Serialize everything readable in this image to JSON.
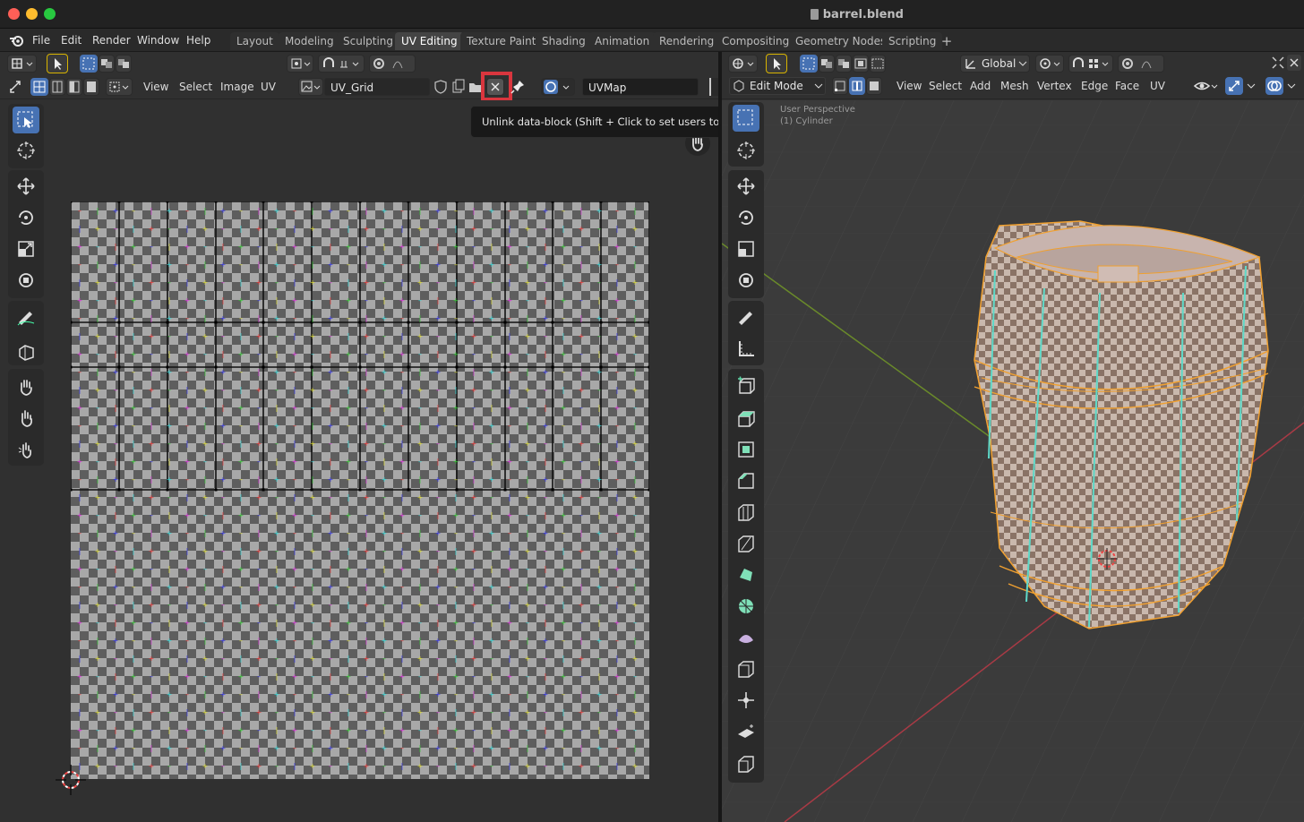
{
  "window": {
    "title": "barrel.blend"
  },
  "menubar": {
    "items": [
      "File",
      "Edit",
      "Render",
      "Window",
      "Help"
    ],
    "workspace_tabs": [
      "Layout",
      "Modeling",
      "Sculpting",
      "UV Editing",
      "Texture Paint",
      "Shading",
      "Animation",
      "Rendering",
      "Compositing",
      "Geometry Nodes",
      "Scripting"
    ],
    "active_tab": "UV Editing",
    "add_workspace": "+"
  },
  "uv_editor": {
    "menus": [
      "View",
      "Select",
      "Image",
      "UV"
    ],
    "image_name": "UV_Grid",
    "uv_map": "UVMap",
    "tooltip": "Unlink data-block (Shift + Click to set users to zero, data will then not be saved)."
  },
  "viewport": {
    "transform_orientation": "Global",
    "mode": "Edit Mode",
    "menus": [
      "View",
      "Select",
      "Add",
      "Mesh",
      "Vertex",
      "Edge",
      "Face",
      "UV"
    ],
    "overlay_text": [
      "User Perspective",
      "(1) Cylinder"
    ]
  },
  "colors": {
    "accent": "#4772b3",
    "highlight": "#d9363e",
    "mesh_edge": "#f0a030",
    "seam": "#5fd9c8"
  }
}
